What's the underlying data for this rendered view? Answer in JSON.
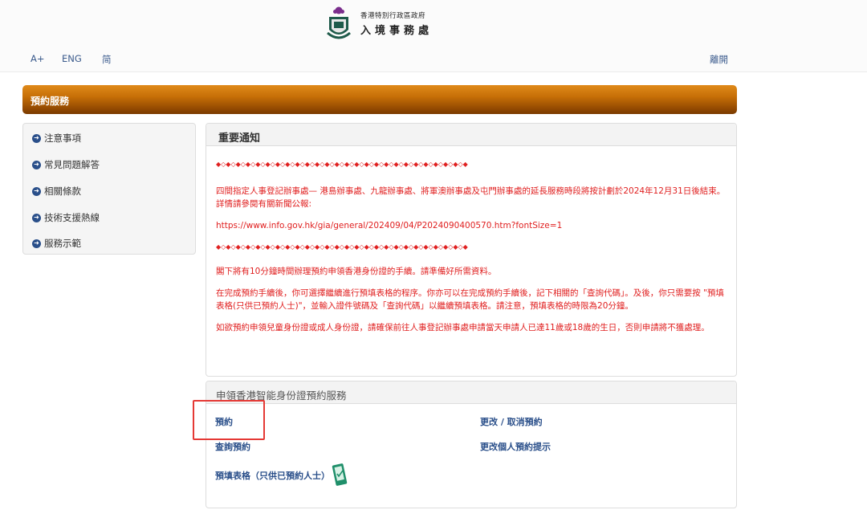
{
  "header": {
    "org_subtitle": "香港特別行政區政府",
    "org_name": "入境事務處",
    "links": {
      "font_size": "A+",
      "english": "ENG",
      "simplified": "简",
      "logout": "離開"
    }
  },
  "banner": {
    "title": "預約服務"
  },
  "sidebar": {
    "items": [
      {
        "label": "注意事項"
      },
      {
        "label": "常見問題解答"
      },
      {
        "label": "相關條款"
      },
      {
        "label": "技術支援熱線"
      },
      {
        "label": "服務示範"
      }
    ]
  },
  "notice": {
    "title": "重要通知",
    "separator": "◆◇◆◇◆◇◆◇◆◇◆◇◆◇◆◇◆◇◆◇◆◇◆◇◆◇◆◇◆◇◆◇◆◇◆◇◆◇◆◇◆◇◆◇◆◇◆◇◆◇◆",
    "p1": "四間指定人事登記辦事處— 港島辦事處、九龍辦事處、將軍澳辦事處及屯門辦事處的延長服務時段將按計劃於2024年12月31日後結束。詳情請參閱有關新聞公報:",
    "url": "https://www.info.gov.hk/gia/general/202409/04/P2024090400570.htm?fontSize=1",
    "p2": "閣下將有10分鐘時間辦理預約申領香港身份證的手續。請準備好所需資料。",
    "p3": "在完成預約手續後，你可選擇繼續進行預填表格的程序。你亦可以在完成預約手續後，記下相關的「查詢代碼」。及後，你只需要按 \"預填表格(只供已預約人士)\"，並輸入證件號碼及「查詢代碼」以繼續預填表格。請注意，預填表格的時限為20分鐘。",
    "p4": "如欲預約申領兒童身份證或成人身份證，請確保前往人事登記辦事處申請當天申請人已達11歲或18歲的生日，否則申請將不獲處理。"
  },
  "service": {
    "title": "申領香港智能身份證預約服務",
    "book": "預約",
    "change_cancel": "更改 / 取消預約",
    "enquire": "查詢預約",
    "change_reminder": "更改個人預約提示",
    "prefill": "預填表格（只供已預約人士）"
  },
  "colors": {
    "accent": "#2a4f8a",
    "notice_text": "#e02020",
    "banner": "#c66f07",
    "highlight": "#e53935"
  }
}
